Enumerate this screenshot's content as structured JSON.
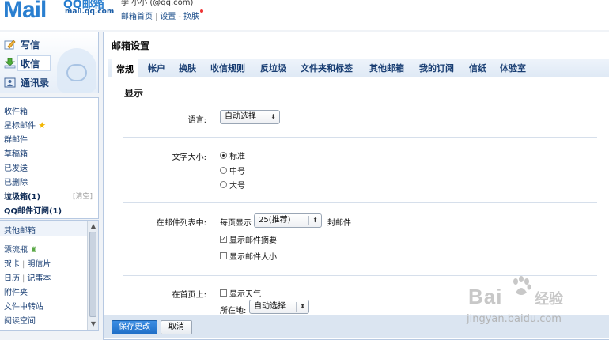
{
  "header": {
    "logo_main": "Mail",
    "logo_qq": "QQ邮箱",
    "logo_url": "mail.qq.com",
    "username": "李 小小 (@qq.com)",
    "links": [
      "邮箱首页",
      "设置",
      "换肤"
    ]
  },
  "quick": {
    "write": "写信",
    "receive": "收信",
    "contacts": "通讯录"
  },
  "folders": {
    "inbox": "收件箱",
    "starred": "星标邮件",
    "group": "群邮件",
    "drafts": "草稿箱",
    "sent": "已发送",
    "deleted": "已删除",
    "spam": "垃圾箱(1)",
    "clear": "[清空]",
    "subscriptions": "QQ邮件订阅(1)"
  },
  "others": {
    "header": "其他邮箱",
    "drift": "漂流瓶",
    "card": "贺卡",
    "postcard": "明信片",
    "calendar": "日历",
    "notes": "记事本",
    "attach": "附件夹",
    "transfer": "文件中转站",
    "reading": "阅读空间"
  },
  "main": {
    "title": "邮箱设置",
    "tabs": [
      "常规",
      "帐户",
      "换肤",
      "收信规则",
      "反垃圾",
      "文件夹和标签",
      "其他邮箱",
      "我的订阅",
      "信纸",
      "体验室"
    ],
    "section": "显示",
    "lang_label": "语言:",
    "lang_value": "自动选择",
    "font_label": "文字大小:",
    "font_opts": [
      "标准",
      "中号",
      "大号"
    ],
    "list_label": "在邮件列表中:",
    "per_page": "每页显示",
    "per_page_value": "25(推荐)",
    "per_page_unit": "封邮件",
    "show_summary": "显示邮件摘要",
    "show_size": "显示邮件大小",
    "home_label": "在首页上:",
    "show_weather": "显示天气",
    "location_label": "所在地:",
    "location_value": "自动选择"
  },
  "footer": {
    "save": "保存更改",
    "cancel": "取消"
  },
  "watermark": {
    "brand": "Bai",
    "jingyan": "经验",
    "url": "jingyan.baidu.com"
  }
}
